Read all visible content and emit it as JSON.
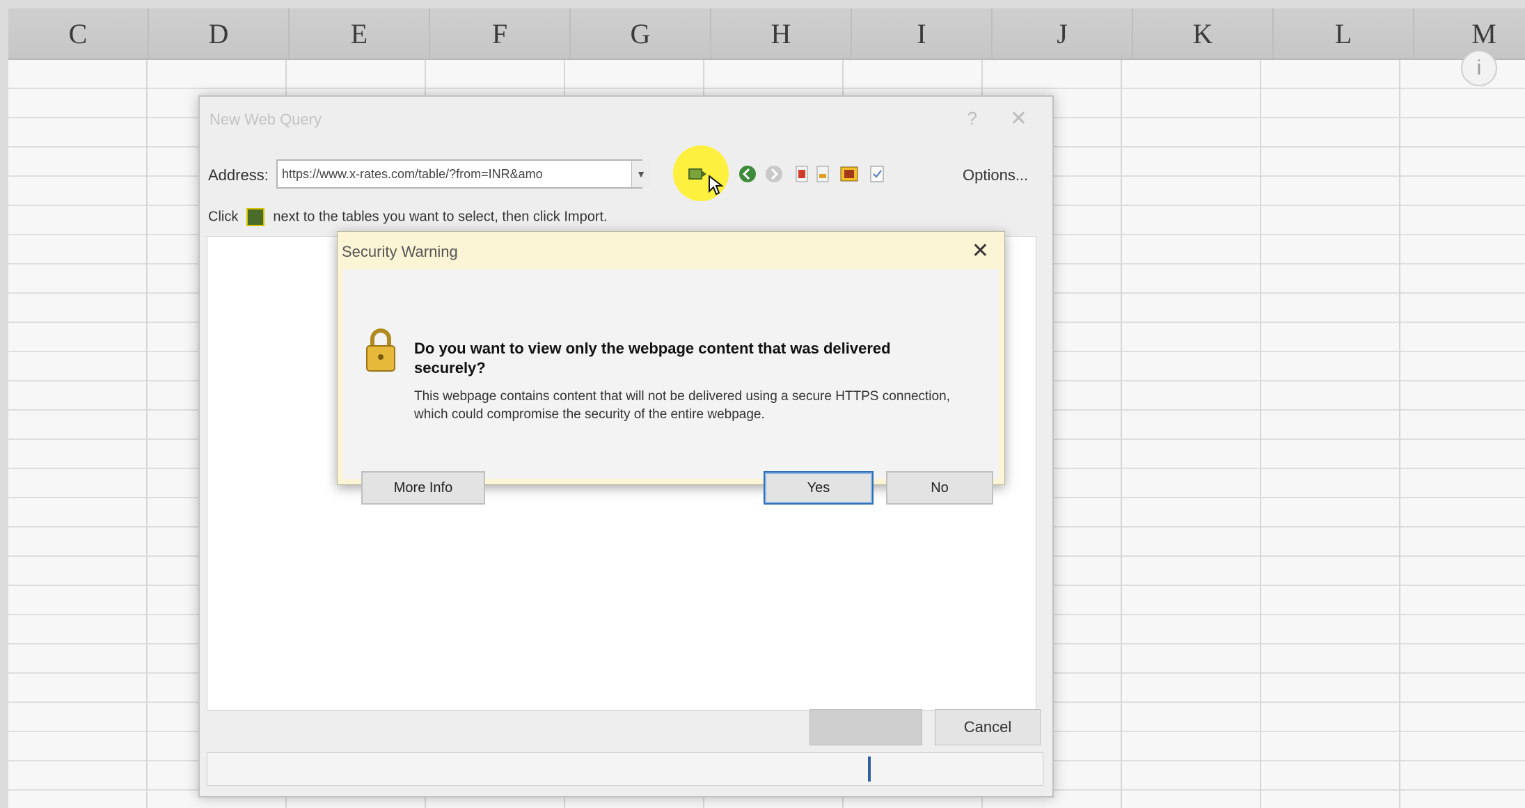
{
  "columns": [
    "C",
    "D",
    "E",
    "F",
    "G",
    "H",
    "I",
    "J",
    "K",
    "L",
    "M"
  ],
  "web_query": {
    "title": "New Web Query",
    "help_glyph": "?",
    "close_glyph": "✕",
    "address_label": "Address:",
    "address_value": "https://www.x-rates.com/table/?from=INR&amo",
    "options_label": "Options...",
    "hint_before": "Click",
    "hint_after": "next to the tables you want to select, then click Import.",
    "import_label": "",
    "cancel_label": "Cancel"
  },
  "security_warning": {
    "title": "Security Warning",
    "close_glyph": "✕",
    "heading": "Do you want to view only the webpage content that was delivered securely?",
    "body": "This webpage contains content that will not be delivered using a secure HTTPS connection, which could compromise the security of the entire webpage.",
    "more_info_label": "More Info",
    "yes_label": "Yes",
    "no_label": "No"
  },
  "icons": [
    "go-icon",
    "back-icon",
    "forward-icon",
    "stop-icon",
    "refresh-icon",
    "hide-icons-icon",
    "save-query-icon",
    "lock-icon",
    "info-icon"
  ],
  "colors": {
    "highlight": "#fff01e",
    "yes_focus": "#2f6fb6",
    "warning_frame": "#fbf5d6"
  }
}
